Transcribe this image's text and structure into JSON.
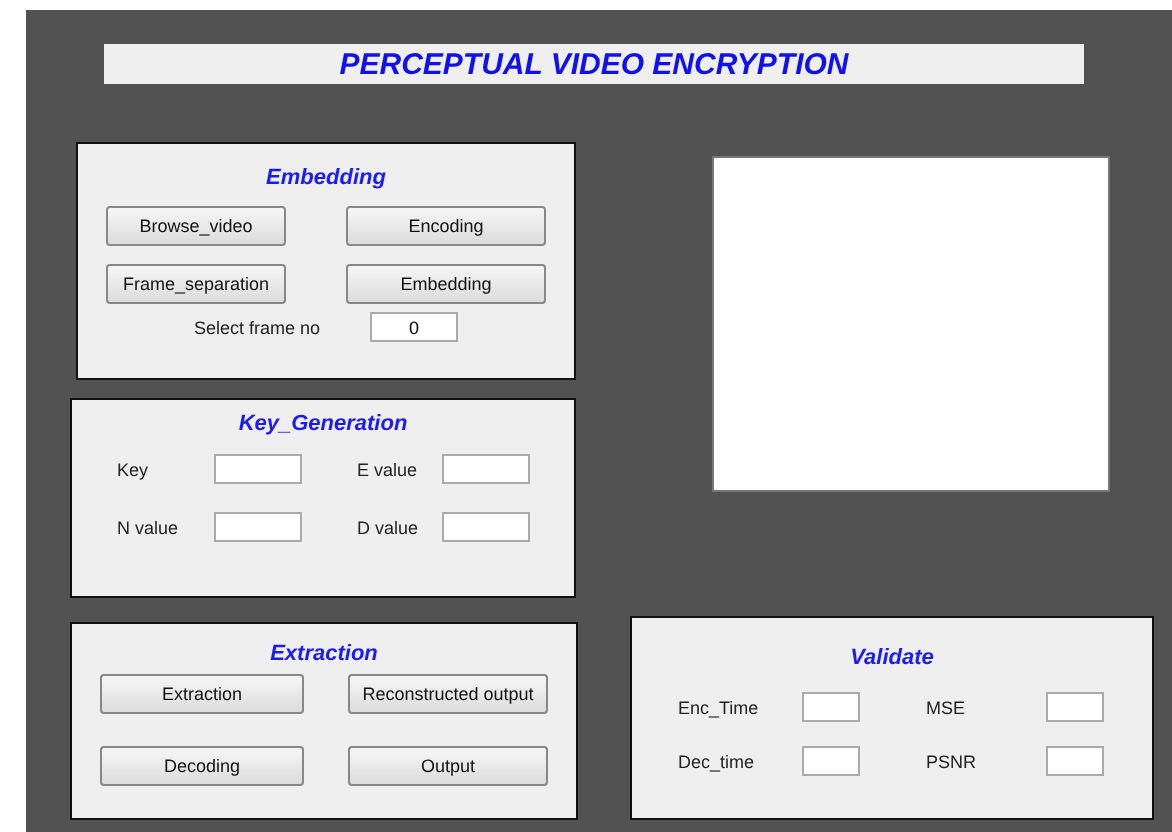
{
  "title": "PERCEPTUAL VIDEO ENCRYPTION",
  "embedding": {
    "title": "Embedding",
    "buttons": [
      "Browse_video",
      "Encoding",
      "Frame_separation",
      "Embedding"
    ],
    "frame_label": "Select frame no",
    "frame_value": "0"
  },
  "key_generation": {
    "title": "Key_Generation",
    "fields": [
      {
        "label": "Key"
      },
      {
        "label": "E value"
      },
      {
        "label": "N value"
      },
      {
        "label": "D value"
      }
    ]
  },
  "extraction": {
    "title": "Extraction",
    "buttons": [
      "Extraction",
      "Reconstructed output",
      "Decoding",
      "Output"
    ]
  },
  "validate": {
    "title": "Validate",
    "fields": [
      {
        "label": "Enc_Time"
      },
      {
        "label": "MSE"
      },
      {
        "label": "Dec_time"
      },
      {
        "label": "PSNR"
      }
    ]
  }
}
